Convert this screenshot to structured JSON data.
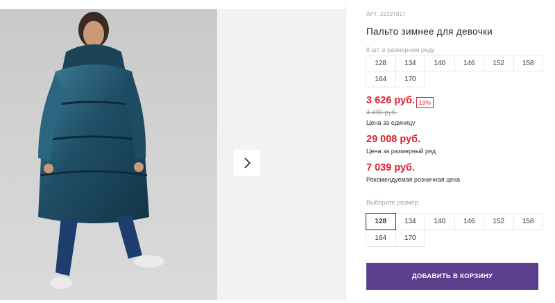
{
  "product": {
    "article": "АРТ. 22327017",
    "title": "Пальто зимнее для девочки"
  },
  "pack_sizes": {
    "label": "8 шт. в размерном ряду",
    "sizes": [
      "128",
      "134",
      "140",
      "146",
      "152",
      "158",
      "164",
      "170"
    ]
  },
  "prices": {
    "unit_price": "3 626 руб.",
    "discount": "19%",
    "old_price": "4 490 руб.",
    "unit_caption": "Цена за единицу",
    "pack_price": "29 008 руб.",
    "pack_caption": "Цена за размерный ряд",
    "retail_price": "7 039 руб.",
    "retail_caption": "Рекомендуемая розничная цена"
  },
  "size_select": {
    "label": "Выберите размер:",
    "sizes": [
      "128",
      "134",
      "140",
      "146",
      "152",
      "158",
      "164",
      "170"
    ],
    "selected": "128"
  },
  "cart": {
    "add_label": "ДОБАВИТЬ В КОРЗИНУ"
  },
  "colors": {
    "price_red": "#e01e2c",
    "button_purple": "#5b3f8c"
  },
  "icons": {
    "next": "chevron-right-icon"
  }
}
